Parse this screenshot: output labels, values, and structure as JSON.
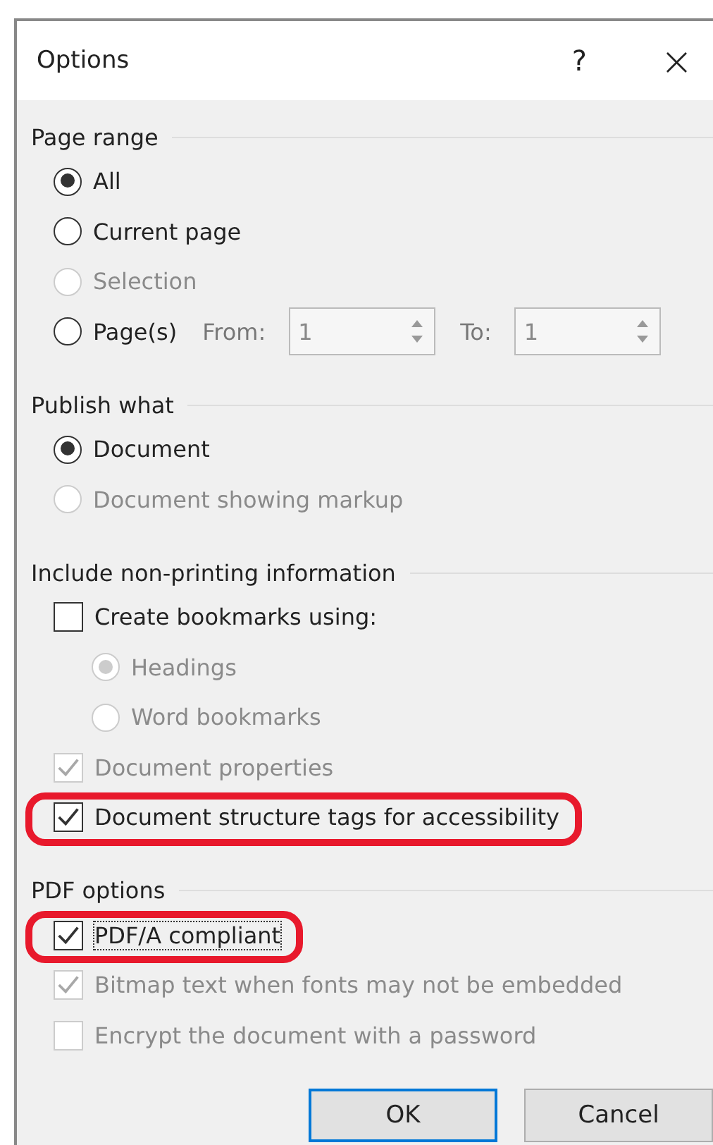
{
  "window": {
    "title": "Options",
    "help": "?",
    "close": "×"
  },
  "sections": [
    {
      "title": "Page range",
      "items": [
        {
          "kind": "radio",
          "label": "All",
          "selected": true,
          "disabled": false
        },
        {
          "kind": "radio",
          "label": "Current page",
          "selected": false,
          "disabled": false
        },
        {
          "kind": "radio",
          "label": "Selection",
          "selected": false,
          "disabled": true
        },
        {
          "kind": "pages",
          "label": "Page(s)",
          "selected": false,
          "disabled": false,
          "from_label": "From:",
          "from_value": "1",
          "to_label": "To:",
          "to_value": "1"
        }
      ]
    },
    {
      "title": "Publish what",
      "items": [
        {
          "kind": "radio",
          "label": "Document",
          "selected": true,
          "disabled": false
        },
        {
          "kind": "radio",
          "label": "Document showing markup",
          "selected": false,
          "disabled": true
        }
      ]
    },
    {
      "title": "Include non-printing information",
      "items": [
        {
          "kind": "checkbox",
          "label": "Create bookmarks using:",
          "checked": false,
          "disabled": false,
          "children": [
            {
              "kind": "radio",
              "label": "Headings",
              "selected": true,
              "disabled": true
            },
            {
              "kind": "radio",
              "label": "Word bookmarks",
              "selected": false,
              "disabled": true
            }
          ]
        },
        {
          "kind": "checkbox",
          "label": "Document properties",
          "checked": true,
          "disabled": true
        },
        {
          "kind": "checkbox",
          "label": "Document structure tags for accessibility",
          "checked": true,
          "disabled": false,
          "highlighted": true
        }
      ]
    },
    {
      "title": "PDF options",
      "items": [
        {
          "kind": "checkbox",
          "label": "PDF/A compliant",
          "checked": true,
          "disabled": false,
          "highlighted": true,
          "focused": true
        },
        {
          "kind": "checkbox",
          "label": "Bitmap text when fonts may not be embedded",
          "checked": true,
          "disabled": true
        },
        {
          "kind": "checkbox",
          "label": "Encrypt the document with a password",
          "checked": false,
          "disabled": true
        }
      ]
    }
  ],
  "buttons": [
    {
      "label": "OK",
      "default": true
    },
    {
      "label": "Cancel",
      "default": false
    }
  ]
}
